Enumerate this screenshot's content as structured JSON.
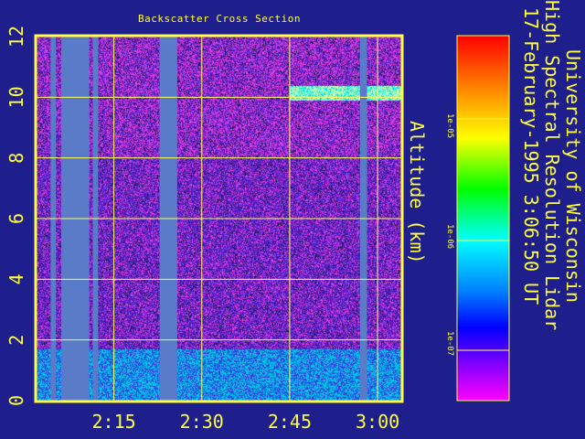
{
  "chart_data": {
    "type": "heatmap",
    "title": "Backscatter Cross Section",
    "ylabel": "Altitude (km)",
    "xlabel": "",
    "ylim": [
      0,
      12
    ],
    "yticks": [
      "0",
      "2",
      "4",
      "6",
      "8",
      "10",
      "12"
    ],
    "xlim_minutes": [
      2.03,
      3.07
    ],
    "xtick_values": [
      2.25,
      2.5,
      2.75,
      3.0
    ],
    "xtick_labels": [
      "2:15",
      "2:30",
      "2:45",
      "3:00"
    ],
    "grid": true,
    "colorbar": {
      "ticks": [
        "1e-05",
        "1e-06",
        "1e-07"
      ],
      "colormap": "rainbow (red high, magenta low)"
    },
    "features": {
      "cirrus_layer_km": [
        9.9,
        10.4
      ],
      "boundary_layer_top_km": 1.7,
      "data_gaps_hours": [
        [
          2.07,
          2.085
        ],
        [
          2.1,
          2.18
        ],
        [
          2.19,
          2.205
        ],
        [
          2.38,
          2.43
        ],
        [
          2.95,
          2.97
        ]
      ]
    }
  },
  "info": {
    "line1": "University of Wisconsin",
    "line2": "High Spectral Resolution Lidar",
    "line3": "17-February-1995  3:06:50 UT"
  },
  "colors": {
    "background": "#1e1e8c",
    "text": "#ffff40",
    "gap": "#5a7bc8",
    "grid": "#ffff60"
  }
}
